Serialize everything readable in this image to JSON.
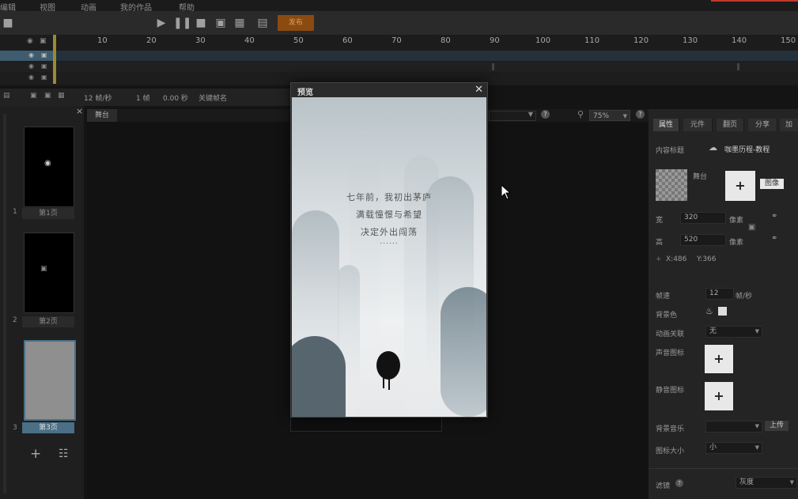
{
  "menu": {
    "items": [
      "编辑",
      "视图",
      "动画",
      "我的作品",
      "帮助"
    ]
  },
  "toolbar": {
    "publish_label": "发布"
  },
  "timeline": {
    "ticks": [
      "10",
      "20",
      "30",
      "40",
      "50",
      "60",
      "70",
      "80",
      "90",
      "100",
      "110",
      "120",
      "130",
      "140",
      "150"
    ]
  },
  "pages_header": {
    "fps": "12 帧/秒",
    "frame": "1 帧",
    "time": "0.00 秒",
    "keyframe": "关键帧名"
  },
  "pages": [
    {
      "num": "1",
      "label": "第1页"
    },
    {
      "num": "2",
      "label": "第2页"
    },
    {
      "num": "3",
      "label": "第3页"
    }
  ],
  "stage": {
    "tab_label": "舞台",
    "zoom": "75%"
  },
  "preview": {
    "title": "预览",
    "lines": [
      "七年前，我初出茅庐",
      "满载憧憬与希望",
      "决定外出闯荡",
      "......"
    ]
  },
  "props": {
    "tabs": [
      "属性",
      "元件",
      "翻页",
      "分享",
      "加"
    ],
    "content_title_label": "内容标题",
    "content_title_value": "咖墨历程-教程",
    "stage_label": "舞台",
    "image_button": "图像",
    "width_label": "宽",
    "width_value": "320",
    "height_label": "高",
    "height_value": "520",
    "px_unit": "像素",
    "x_readout": "X:486",
    "y_readout": "Y:366",
    "fps_label": "帧速",
    "fps_value": "12",
    "fps_unit": "帧/秒",
    "bg_color_label": "背景色",
    "anim_link_label": "动画关联",
    "anim_link_value": "无",
    "sound_label": "声音图标",
    "mute_label": "静音图标",
    "bg_music_label": "背景音乐",
    "upload_button": "上传",
    "icon_size_label": "图标大小",
    "icon_size_value": "小",
    "filter_label": "滤镜",
    "filter_value": "灰度"
  },
  "colors": {
    "publish_bg": "#8a4a10",
    "accent_red": "#c0392b",
    "playhead": "#9a8a30",
    "page_selected": "#4a6f86"
  }
}
